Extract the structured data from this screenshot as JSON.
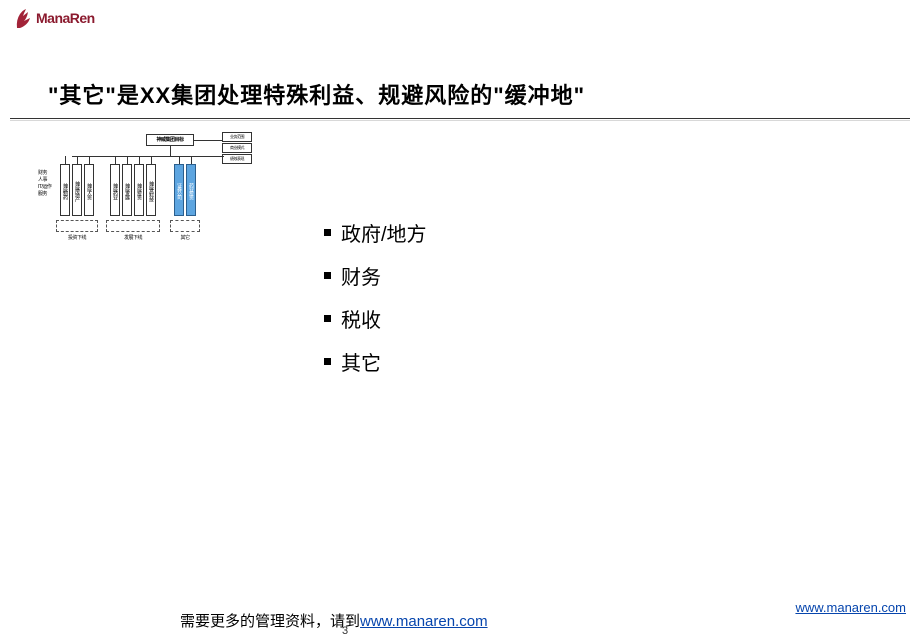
{
  "logo_text": "ManaRen",
  "title_prefix": "\"其它\"是",
  "title_xx": "XX",
  "title_suffix": "集团处理特殊利益、规避风险的\"缓冲地\"",
  "org": {
    "top": "神威集团目标",
    "right": [
      "业务范围",
      "商业模式",
      "绩效表现"
    ],
    "left_labels": [
      "财务",
      "人事",
      "IT/运作",
      "服务"
    ],
    "cols": [
      {
        "label": "神威制药",
        "blue": false
      },
      {
        "label": "神威房地产",
        "blue": false
      },
      {
        "label": "神威人资",
        "blue": false
      },
      {
        "label": "神威药业",
        "blue": false
      },
      {
        "label": "神威发展",
        "blue": false
      },
      {
        "label": "神威投资",
        "blue": false
      },
      {
        "label": "神威高科技",
        "blue": false
      },
      {
        "label": "证券公司",
        "blue": true
      },
      {
        "label": "药业投资",
        "blue": true
      }
    ],
    "groups": [
      {
        "label": "投资下线",
        "start": 0,
        "end": 2
      },
      {
        "label": "发展下线",
        "start": 3,
        "end": 6
      },
      {
        "label": "其它",
        "start": 7,
        "end": 8
      }
    ]
  },
  "bullets": [
    "政府/地方",
    "财务",
    "税收",
    "其它"
  ],
  "footer_text": "需要更多的管理资料，请到",
  "footer_link": "www.manaren.com",
  "page_number": "3",
  "corner_link": "www.manaren.com"
}
